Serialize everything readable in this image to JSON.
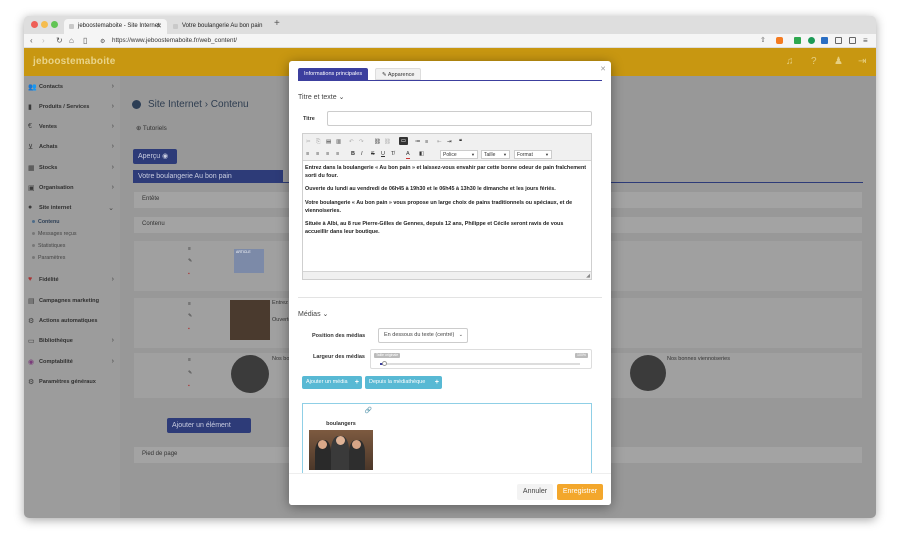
{
  "browser": {
    "tabs": [
      {
        "label": "jeboostemaboite - Site Internet"
      },
      {
        "label": "Votre boulangerie Au bon pain"
      }
    ],
    "url": "https://www.jeboostemaboite.fr/web_content/"
  },
  "app": {
    "logo": "jeboostemaboite"
  },
  "sidebar": {
    "items": [
      {
        "label": "Contacts",
        "icon": "users-icon"
      },
      {
        "label": "Produits / Services",
        "icon": "bars-icon"
      },
      {
        "label": "Ventes",
        "icon": "euro-icon"
      },
      {
        "label": "Achats",
        "icon": "cart-icon"
      },
      {
        "label": "Stocks",
        "icon": "box-icon"
      },
      {
        "label": "Organisation",
        "icon": "calendar-icon"
      },
      {
        "label": "Site internet",
        "icon": "globe-icon"
      },
      {
        "label": "Fidélité",
        "icon": "heart-icon"
      },
      {
        "label": "Campagnes marketing",
        "icon": "chart-icon"
      },
      {
        "label": "Actions automatiques",
        "icon": "gear-icon"
      },
      {
        "label": "Bibliothèque",
        "icon": "folder-icon"
      },
      {
        "label": "Comptabilité",
        "icon": "coins-icon"
      },
      {
        "label": "Paramètres généraux",
        "icon": "settings-icon"
      }
    ],
    "subitems": [
      {
        "label": "Contenu"
      },
      {
        "label": "Messages reçus"
      },
      {
        "label": "Statistiques"
      },
      {
        "label": "Paramètres"
      }
    ]
  },
  "main": {
    "page_title": "Site Internet › Contenu",
    "tutoriels": "Tutoriels",
    "apercu": "Aperçu",
    "page_name": "Votre boulangerie Au bon pain",
    "entete": "Entête",
    "contenu": "Contenu",
    "row2_text": "Entrez dans la bo",
    "row2_text2": "Ouverte du lundi",
    "row3_text": "Nos bons pains",
    "row3_text_right": "Nos bonnes viennoiseries",
    "article_label": "ARTICLE",
    "ajouter_element": "Ajouter un élément",
    "pied_de_page": "Pied de page"
  },
  "modal": {
    "tabs": [
      {
        "label": "Informations principales"
      },
      {
        "label": "Apparence"
      }
    ],
    "section_titre": "Titre et texte",
    "titre_label": "Titre",
    "titre_value": "",
    "toolbar": {
      "police": "Police",
      "taille": "Taille",
      "format": "Format"
    },
    "paragraphs": [
      "Entrez dans la boulangerie « Au bon pain » et laissez-vous envahir par cette bonne odeur de pain fraîchement sorti du four.",
      "Ouverte du lundi au vendredi de 06h45 à 19h30 et le 06h45 à 13h30 le dimanche et les jours fériés.",
      "Votre boulangerie « Au bon pain » vous propose un large choix de pains traditionnels ou spéciaux, et de viennoiseries.",
      "Située à Albi, au 8 rue Pierre-Gilles de Gennes, depuis 12 ans, Philippe et Cécile seront ravis de vous accueillir dans leur boutique."
    ],
    "section_medias": "Médias",
    "position_label": "Position des médias",
    "position_value": "En dessous du texte (centré)",
    "largeur_label": "Largeur des médias",
    "largeur_min": "Taille originale",
    "largeur_max": "100%",
    "largeur_value": 0.02,
    "btn_ajouter_media": "Ajouter un média",
    "btn_mediatheque": "Depuis la médiathèque",
    "media_name": "boulangers",
    "btn_annuler": "Annuler",
    "btn_enregistrer": "Enregistrer"
  },
  "colors": {
    "header": "#c89711",
    "modal_accent": "#3c3f9e",
    "media_button": "#58b9d4",
    "save_button": "#f3a72c"
  }
}
